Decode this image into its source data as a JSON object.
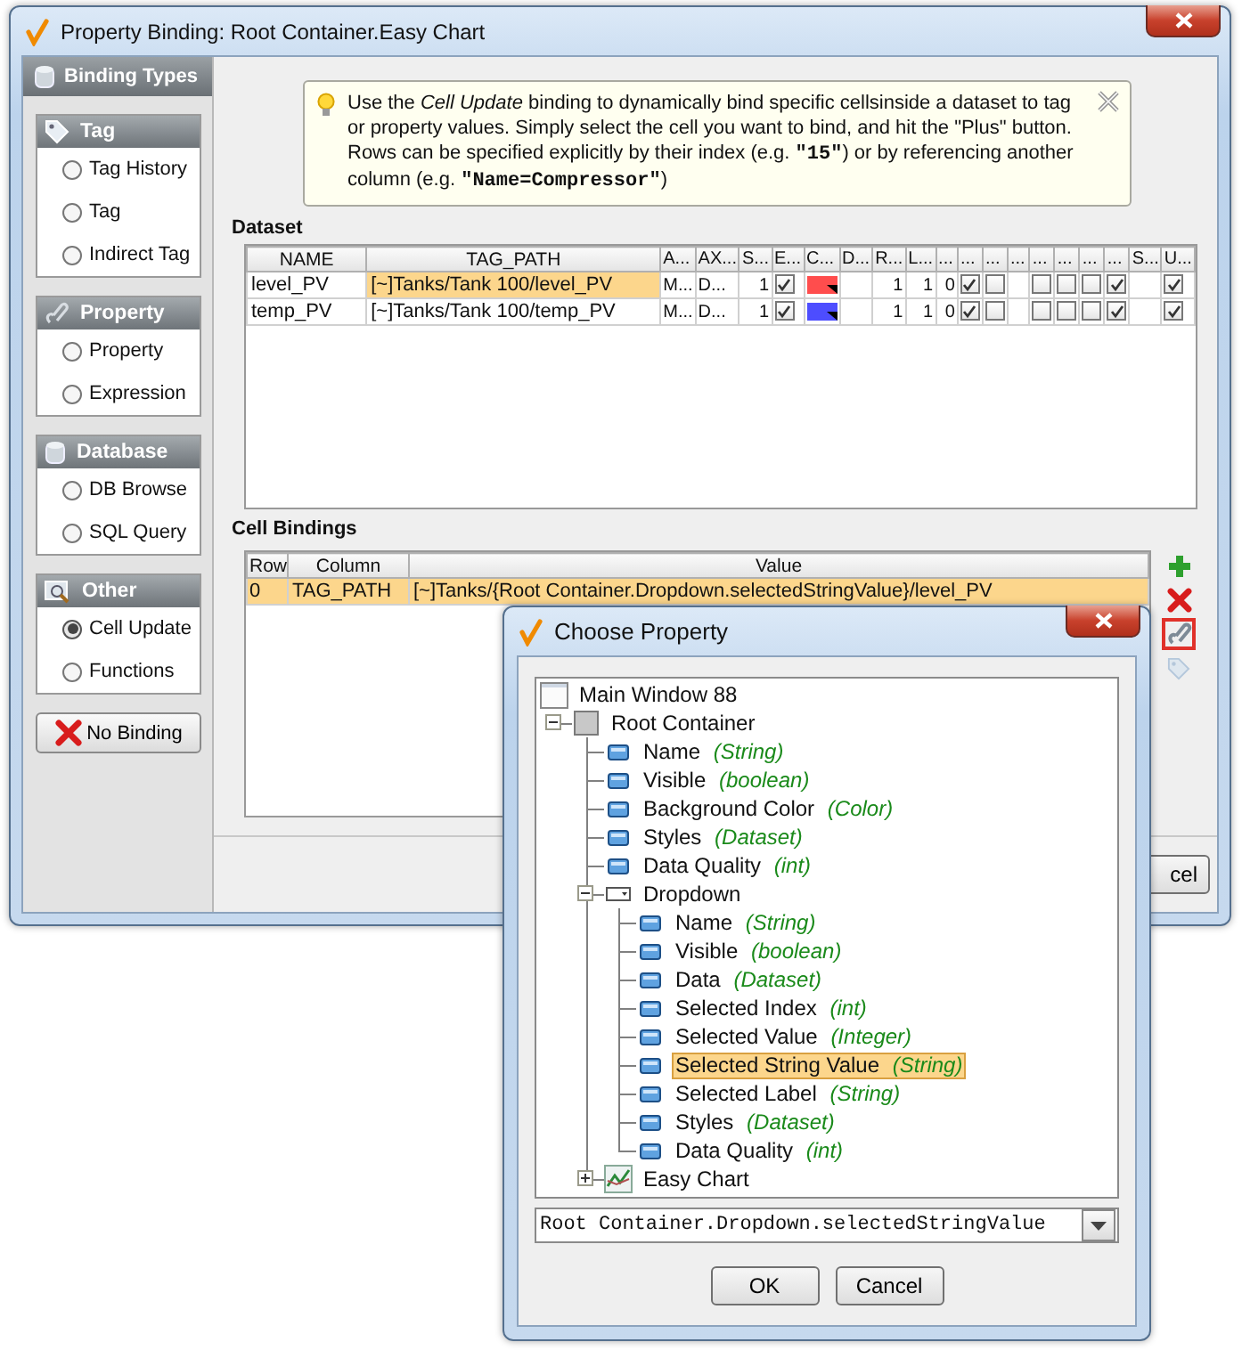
{
  "window": {
    "title": "Property Binding: Root Container.Easy Chart"
  },
  "sidebar": {
    "title": "Binding Types",
    "groups": [
      {
        "title": "Tag",
        "items": [
          {
            "label": "Tag History",
            "selected": false
          },
          {
            "label": "Tag",
            "selected": false
          },
          {
            "label": "Indirect Tag",
            "selected": false
          }
        ]
      },
      {
        "title": "Property",
        "items": [
          {
            "label": "Property",
            "selected": false
          },
          {
            "label": "Expression",
            "selected": false
          }
        ]
      },
      {
        "title": "Database",
        "items": [
          {
            "label": "DB Browse",
            "selected": false
          },
          {
            "label": "SQL Query",
            "selected": false
          }
        ]
      },
      {
        "title": "Other",
        "items": [
          {
            "label": "Cell Update",
            "selected": true
          },
          {
            "label": "Functions",
            "selected": false
          }
        ]
      }
    ],
    "no_binding_button": "No Binding"
  },
  "info": {
    "segments": [
      {
        "kind": "plain",
        "text": "Use the "
      },
      {
        "kind": "italic",
        "text": "Cell Update"
      },
      {
        "kind": "plain",
        "text": " binding to dynamically bind specific cellsinside a dataset to tag or property values. Simply select the cell you want to bind, and hit the \"Plus\" button. Rows can be specified explicitly by their index (e.g. "
      },
      {
        "kind": "code",
        "text": "\"15\""
      },
      {
        "kind": "plain",
        "text": ") or by referencing another column (e.g. "
      },
      {
        "kind": "code",
        "text": "\"Name=Compressor\""
      },
      {
        "kind": "plain",
        "text": ")"
      }
    ]
  },
  "dataset": {
    "title": "Dataset",
    "columns": [
      "NAME",
      "TAG_PATH",
      "A...",
      "AX...",
      "S...",
      "E...",
      "C...",
      "D...",
      "R...",
      "L...",
      "...",
      "...",
      "...",
      "...",
      "...",
      "...",
      "...",
      "...",
      "S...",
      "U..."
    ],
    "rows": [
      {
        "cells": [
          {
            "kind": "text",
            "text": "level_PV",
            "selected": false
          },
          {
            "kind": "text",
            "text": "[~]Tanks/Tank 100/level_PV",
            "selected": true
          },
          {
            "kind": "text",
            "text": "M...",
            "selected": false
          },
          {
            "kind": "text",
            "text": "D...",
            "selected": false
          },
          {
            "kind": "number",
            "text": "1",
            "selected": false
          },
          {
            "kind": "check",
            "checked": true,
            "selected": false
          },
          {
            "kind": "color",
            "color": "#ff4d4d",
            "selected": false
          },
          {
            "kind": "blank",
            "selected": false
          },
          {
            "kind": "number",
            "text": "1",
            "selected": false
          },
          {
            "kind": "number",
            "text": "1",
            "selected": false
          },
          {
            "kind": "number",
            "text": "0",
            "selected": false
          },
          {
            "kind": "check",
            "checked": true,
            "selected": false
          },
          {
            "kind": "check",
            "checked": false,
            "selected": false
          },
          {
            "kind": "blank",
            "selected": false
          },
          {
            "kind": "check",
            "checked": false,
            "selected": false
          },
          {
            "kind": "check",
            "checked": false,
            "selected": false
          },
          {
            "kind": "check",
            "checked": false,
            "selected": false
          },
          {
            "kind": "check",
            "checked": true,
            "selected": false
          },
          {
            "kind": "blank",
            "selected": false
          },
          {
            "kind": "check",
            "checked": true,
            "selected": false
          }
        ]
      },
      {
        "cells": [
          {
            "kind": "text",
            "text": "temp_PV",
            "selected": false
          },
          {
            "kind": "text",
            "text": "[~]Tanks/Tank 100/temp_PV",
            "selected": false
          },
          {
            "kind": "text",
            "text": "M...",
            "selected": false
          },
          {
            "kind": "text",
            "text": "D...",
            "selected": false
          },
          {
            "kind": "number",
            "text": "1",
            "selected": false
          },
          {
            "kind": "check",
            "checked": true,
            "selected": false
          },
          {
            "kind": "color",
            "color": "#4d4dff",
            "selected": false
          },
          {
            "kind": "blank",
            "selected": false
          },
          {
            "kind": "number",
            "text": "1",
            "selected": false
          },
          {
            "kind": "number",
            "text": "1",
            "selected": false
          },
          {
            "kind": "number",
            "text": "0",
            "selected": false
          },
          {
            "kind": "check",
            "checked": true,
            "selected": false
          },
          {
            "kind": "check",
            "checked": false,
            "selected": false
          },
          {
            "kind": "blank",
            "selected": false
          },
          {
            "kind": "check",
            "checked": false,
            "selected": false
          },
          {
            "kind": "check",
            "checked": false,
            "selected": false
          },
          {
            "kind": "check",
            "checked": false,
            "selected": false
          },
          {
            "kind": "check",
            "checked": true,
            "selected": false
          },
          {
            "kind": "blank",
            "selected": false
          },
          {
            "kind": "check",
            "checked": true,
            "selected": false
          }
        ]
      }
    ]
  },
  "cell_bindings": {
    "title": "Cell Bindings",
    "columns": [
      "Row",
      "Column",
      "Value"
    ],
    "rows": [
      {
        "selected": true,
        "cells": [
          "0",
          "TAG_PATH",
          "[~]Tanks/{Root Container.Dropdown.selectedStringValue}/level_PV"
        ]
      }
    ]
  },
  "tools": [
    {
      "kind": "add",
      "selected": false,
      "disabled": false
    },
    {
      "kind": "remove",
      "selected": false,
      "disabled": false
    },
    {
      "kind": "link",
      "selected": true,
      "disabled": false
    },
    {
      "kind": "tag",
      "selected": false,
      "disabled": true
    }
  ],
  "buttons": [
    "cel"
  ],
  "dialog": {
    "title": "Choose Property",
    "tree": [
      {
        "kind": "window",
        "label": "Main Window 88",
        "expanded": true,
        "selected": false,
        "children": [
          {
            "kind": "container",
            "label": "Root Container",
            "expanded": true,
            "selected": false,
            "children": [
              {
                "kind": "property",
                "label": "Name",
                "type": "(String)",
                "selected": false
              },
              {
                "kind": "property",
                "label": "Visible",
                "type": "(boolean)",
                "selected": false
              },
              {
                "kind": "property",
                "label": "Background Color",
                "type": "(Color)",
                "selected": false
              },
              {
                "kind": "property",
                "label": "Styles",
                "type": "(Dataset)",
                "selected": false
              },
              {
                "kind": "property",
                "label": "Data Quality",
                "type": "(int)",
                "selected": false
              },
              {
                "kind": "dropdown",
                "label": "Dropdown",
                "expanded": true,
                "selected": false,
                "children": [
                  {
                    "kind": "property",
                    "label": "Name",
                    "type": "(String)",
                    "selected": false
                  },
                  {
                    "kind": "property",
                    "label": "Visible",
                    "type": "(boolean)",
                    "selected": false
                  },
                  {
                    "kind": "property",
                    "label": "Data",
                    "type": "(Dataset)",
                    "selected": false
                  },
                  {
                    "kind": "property",
                    "label": "Selected Index",
                    "type": "(int)",
                    "selected": false
                  },
                  {
                    "kind": "property",
                    "label": "Selected Value",
                    "type": "(Integer)",
                    "selected": false
                  },
                  {
                    "kind": "property",
                    "label": "Selected String Value",
                    "type": "(String)",
                    "selected": true
                  },
                  {
                    "kind": "property",
                    "label": "Selected Label",
                    "type": "(String)",
                    "selected": false
                  },
                  {
                    "kind": "property",
                    "label": "Styles",
                    "type": "(Dataset)",
                    "selected": false
                  },
                  {
                    "kind": "property",
                    "label": "Data Quality",
                    "type": "(int)",
                    "selected": false
                  }
                ]
              },
              {
                "kind": "chart",
                "label": "Easy Chart",
                "expanded": false,
                "selected": false
              }
            ]
          }
        ]
      }
    ],
    "path_field": {
      "value": "Root Container.Dropdown.selectedStringValue"
    },
    "buttons": [
      "OK",
      "Cancel"
    ]
  }
}
